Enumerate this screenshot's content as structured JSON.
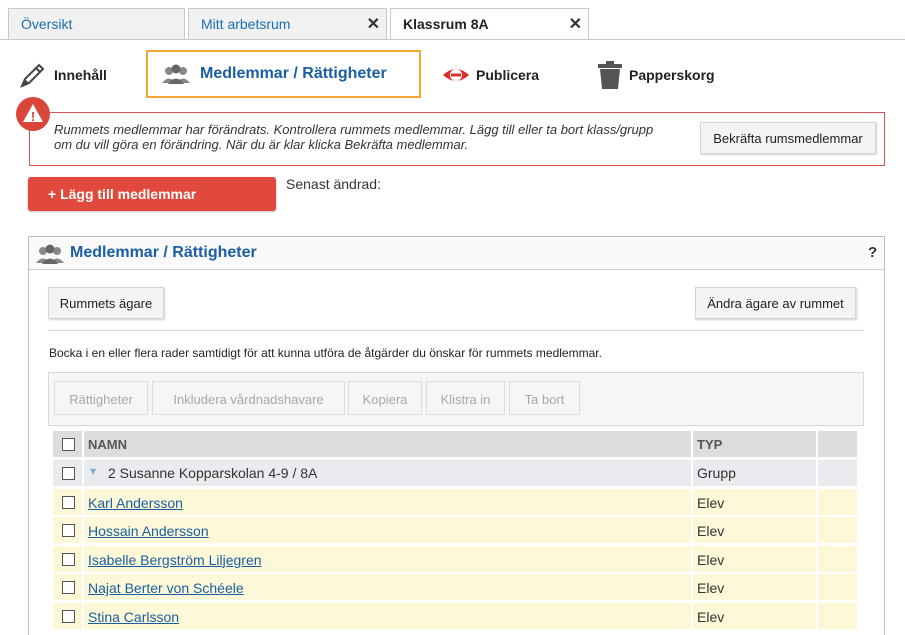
{
  "tabs": [
    {
      "label": "Översikt"
    },
    {
      "label": "Mitt arbetsrum",
      "close": "✕"
    },
    {
      "label": "Klassrum 8A",
      "close": "✕"
    }
  ],
  "toolbar": {
    "content": "Innehåll",
    "members": "Medlemmar / Rättigheter",
    "publish": "Publicera",
    "trash": "Papperskorg"
  },
  "warning": {
    "icon": "!",
    "text": "Rummets medlemmar har förändrats. Kontrollera rummets medlemmar. Lägg till eller ta bort klass/grupp om du vill göra en förändring. När du är klar klicka Bekräfta medlemmar.",
    "confirm_button": "Bekräfta rumsmedlemmar"
  },
  "add_members_button": "+ Lägg till medlemmar",
  "last_changed_label": "Senast ändrad:",
  "panel": {
    "title": "Medlemmar / Rättigheter",
    "help": "?",
    "owners_button": "Rummets ägare",
    "change_owner_button": "Ändra ägare av rummet",
    "instruction": "Bocka i en eller flera rader samtidigt för att kunna utföra de åtgärder du önskar för rummets medlemmar.",
    "actions": [
      "Rättigheter",
      "Inkludera vårdnadshavare",
      "Kopiera",
      "Klistra in",
      "Ta bort"
    ]
  },
  "table": {
    "headers": {
      "name": "NAMN",
      "type": "TYP"
    },
    "group_row": {
      "caret": "▾",
      "name": "2 Susanne Kopparskolan 4-9 / 8A",
      "type": "Grupp"
    },
    "rows": [
      {
        "name": "Karl Andersson",
        "type": "Elev"
      },
      {
        "name": "Hossain Andersson",
        "type": "Elev"
      },
      {
        "name": "Isabelle Bergström Liljegren",
        "type": "Elev"
      },
      {
        "name": "Najat Berter von Schéele",
        "type": "Elev"
      },
      {
        "name": "Stina Carlsson",
        "type": "Elev"
      }
    ]
  },
  "colors": {
    "accent": "#1a5fa3",
    "warning": "#d9534f",
    "primary_button": "#e0493b",
    "selected_border": "#f0a733",
    "row_highlight": "#fdf8d8"
  }
}
